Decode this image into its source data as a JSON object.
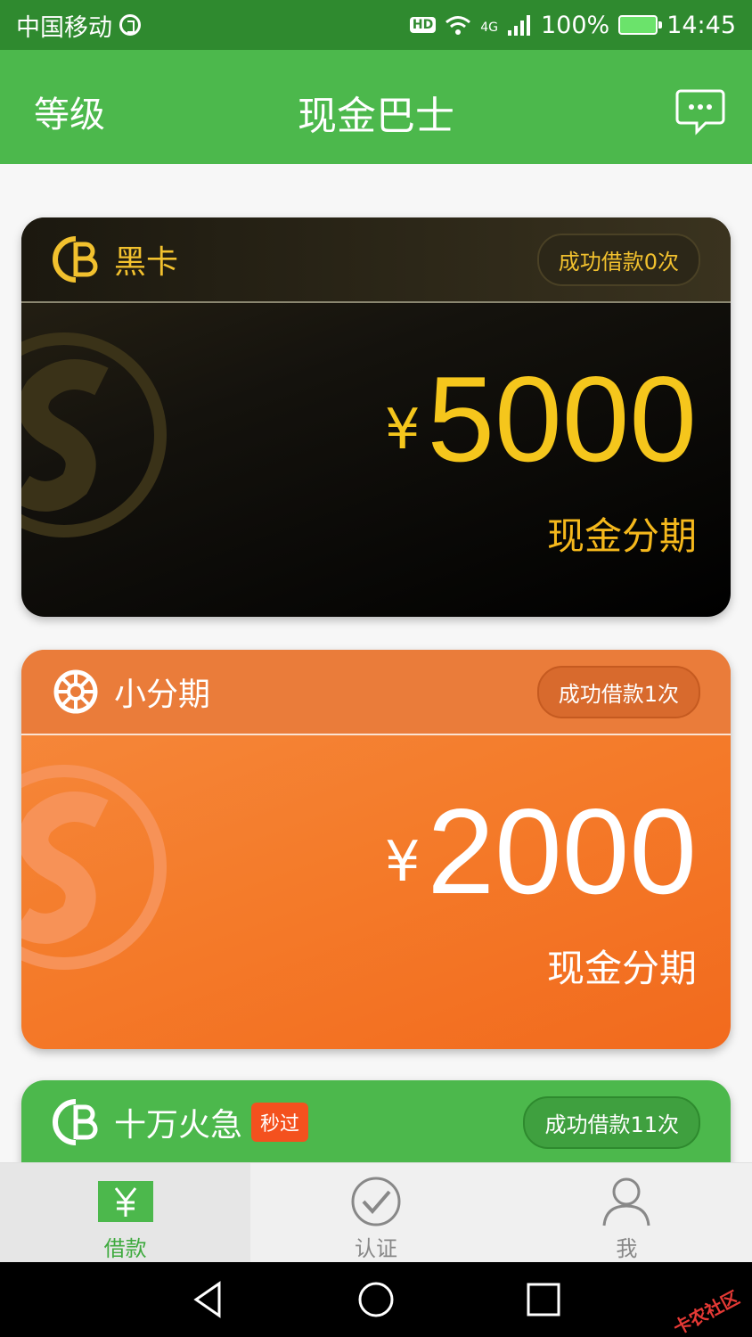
{
  "status_bar": {
    "carrier": "中国移动",
    "network": "4G",
    "battery": "100%",
    "time": "14:45"
  },
  "app_bar": {
    "left_label": "等级",
    "title": "现金巴士",
    "chat_icon": "chat-bubble-icon"
  },
  "cards": [
    {
      "name": "黑卡",
      "badge": "成功借款0次",
      "currency": "¥",
      "amount": "5000",
      "subtitle": "现金分期",
      "accent": "#f5c61c"
    },
    {
      "name": "小分期",
      "badge": "成功借款1次",
      "currency": "¥",
      "amount": "2000",
      "subtitle": "现金分期",
      "accent": "#f47b2a"
    },
    {
      "name": "十万火急",
      "tag": "秒过",
      "badge": "成功借款11次",
      "accent": "#4cb84c"
    }
  ],
  "tabs": [
    {
      "label": "借款",
      "icon": "yen-icon",
      "active": true
    },
    {
      "label": "认证",
      "icon": "check-circle-icon",
      "active": false
    },
    {
      "label": "我",
      "icon": "person-icon",
      "active": false
    }
  ],
  "watermark": "卡农社区"
}
